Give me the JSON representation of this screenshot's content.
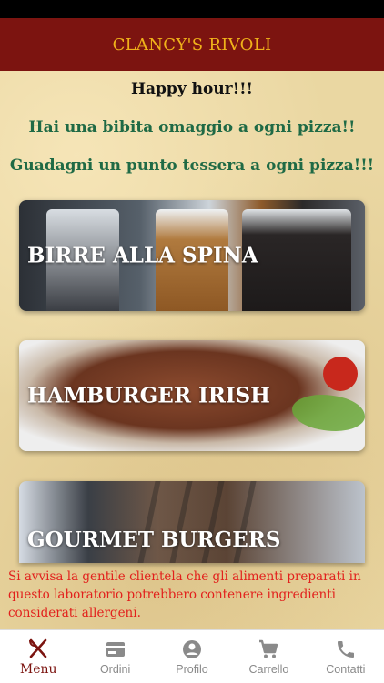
{
  "header": {
    "title": "CLANCY'S RIVOLI"
  },
  "promo": {
    "headline": "Happy hour!!!",
    "line1": "Hai una bibita omaggio a ogni pizza!!",
    "line2": "Guadagni un punto tessera a ogni pizza!!!"
  },
  "menu_cards": [
    {
      "label": "BIRRE ALLA SPINA",
      "image": "draft-beer-glasses"
    },
    {
      "label": "HAMBURGER IRISH",
      "image": "grilled-burger-patty"
    },
    {
      "label": "GOURMET BURGERS",
      "image": "gourmet-burger-patty"
    }
  ],
  "disclaimer": "Si avvisa la gentile clientela che gli alimenti preparati in questo laboratorio potrebbero contenere ingredienti considerati allergeni.",
  "tabbar": {
    "tabs": [
      {
        "label": "Menu",
        "icon": "fork-knife-icon",
        "active": true
      },
      {
        "label": "Ordini",
        "icon": "card-icon",
        "active": false
      },
      {
        "label": "Profilo",
        "icon": "account-icon",
        "active": false
      },
      {
        "label": "Carrello",
        "icon": "cart-icon",
        "active": false
      },
      {
        "label": "Contatti",
        "icon": "phone-icon",
        "active": false
      }
    ]
  },
  "colors": {
    "header_bg": "#7c1410",
    "header_text": "#f0b21a",
    "promo_green": "#1f6a45",
    "disclaimer_red": "#e2201c"
  }
}
